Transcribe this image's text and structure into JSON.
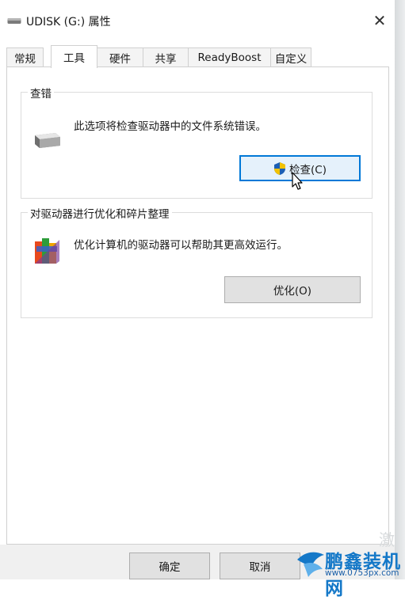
{
  "window": {
    "title": "UDISK (G:) 属性",
    "close_symbol": "✕"
  },
  "tabs": [
    {
      "label": "常规",
      "active": false
    },
    {
      "label": "工具",
      "active": true
    },
    {
      "label": "硬件",
      "active": false
    },
    {
      "label": "共享",
      "active": false
    },
    {
      "label": "ReadyBoost",
      "active": false
    },
    {
      "label": "自定义",
      "active": false
    }
  ],
  "error_check": {
    "legend": "查错",
    "description": "此选项将检查驱动器中的文件系统错误。",
    "button_label": "检查(C)",
    "icon": "drive-icon"
  },
  "optimize": {
    "legend": "对驱动器进行优化和碎片整理",
    "description": "优化计算机的驱动器可以帮助其更高效运行。",
    "button_label": "优化(O)",
    "icon": "defrag-icon"
  },
  "footer": {
    "ok_label": "确定",
    "cancel_label": "取消"
  },
  "watermark": {
    "faint_text": "激",
    "brand_text": "鹏鑫装机网",
    "url": "www.0753px.com"
  },
  "colors": {
    "focus_border": "#0078d7",
    "focus_fill": "#e5f1fb",
    "button_face": "#e1e1e1",
    "watermark_blue": "#1478c8"
  }
}
